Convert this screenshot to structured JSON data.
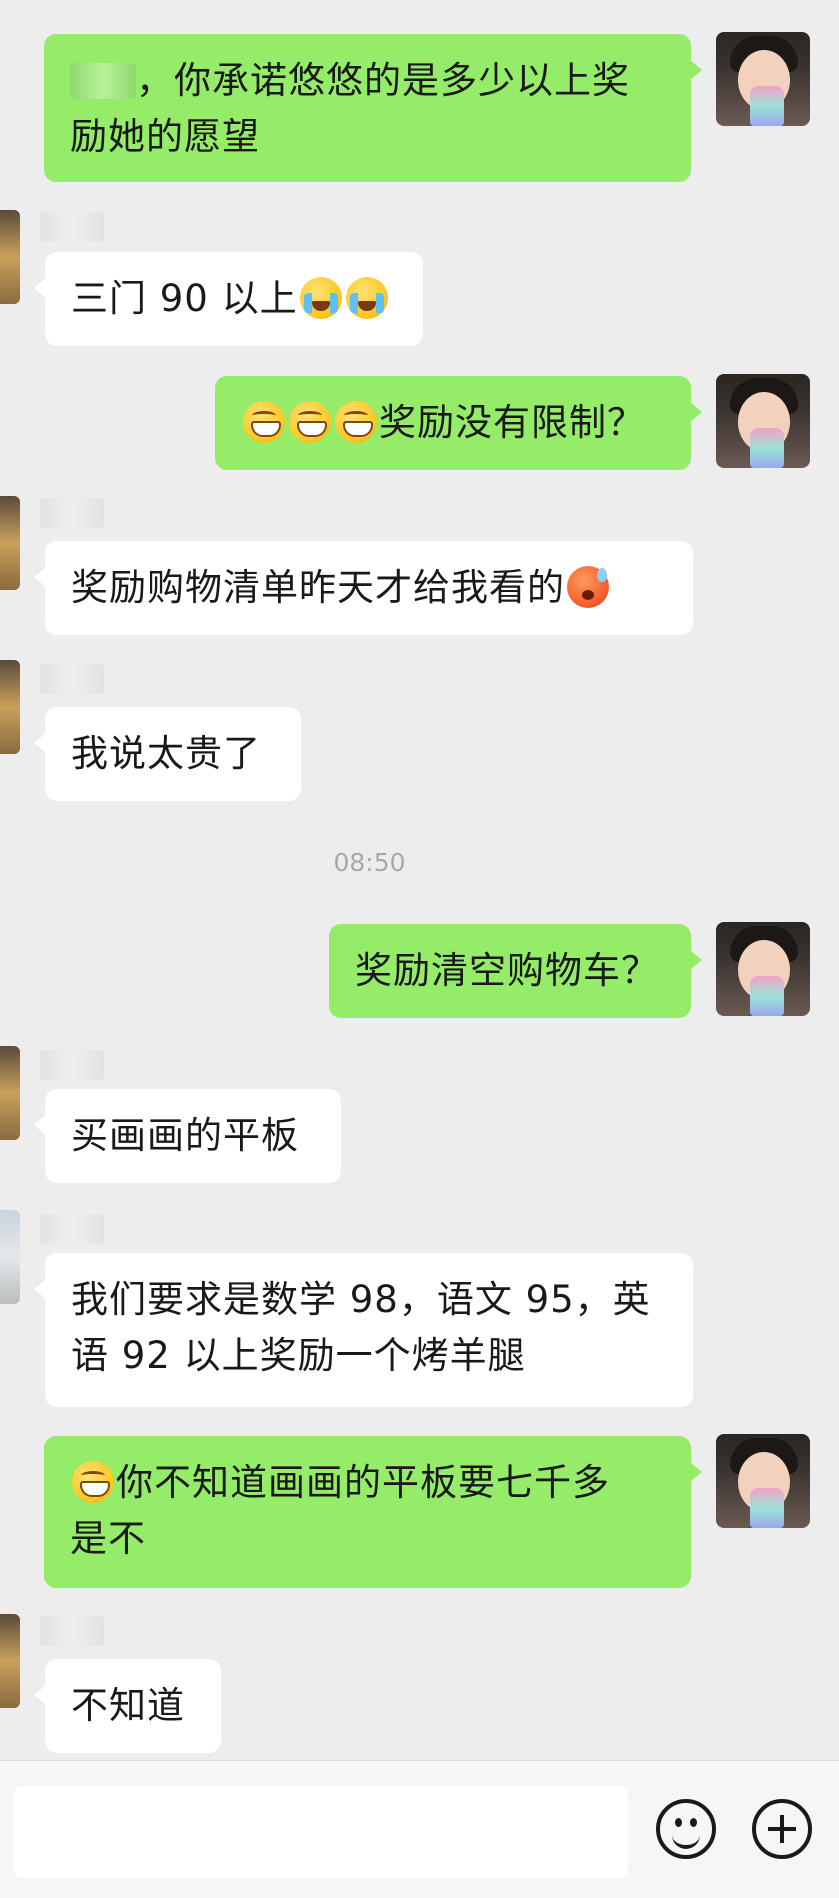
{
  "messages": [
    {
      "side": "mine",
      "pre_text": "，你承诺悠悠的是多少以上奖",
      "text2": "励她的愿望"
    },
    {
      "side": "theirs",
      "text": "三门 90 以上",
      "emojis": [
        "cry-laugh-icon",
        "cry-laugh-icon"
      ]
    },
    {
      "side": "mine",
      "emojis": [
        "grin-icon",
        "grin-icon",
        "grin-icon"
      ],
      "text": "奖励没有限制？"
    },
    {
      "side": "theirs",
      "text": "奖励购物清单昨天才给我看的",
      "emojis": [
        "flushed-sweat-icon"
      ]
    },
    {
      "side": "theirs",
      "text": "我说太贵了"
    },
    {
      "side": "mine",
      "text": "奖励清空购物车？"
    },
    {
      "side": "theirs",
      "text": "买画画的平板"
    },
    {
      "side": "theirs",
      "text": "我们要求是数学 98，语文 95，英",
      "text2": "语 92 以上奖励一个烤羊腿"
    },
    {
      "side": "mine",
      "emojis": [
        "grin-icon"
      ],
      "text": "你不知道画画的平板要七千多",
      "text2": "是不"
    },
    {
      "side": "theirs",
      "text": "不知道"
    }
  ],
  "timestamp": "08:50",
  "composer": {
    "input_value": "",
    "emoji_button_icon": "smiley-face-icon",
    "plus_button_icon": "plus-circle-icon"
  },
  "colors": {
    "mine_bubble": "#95ec69",
    "theirs_bubble": "#ffffff",
    "background": "#ededed"
  }
}
